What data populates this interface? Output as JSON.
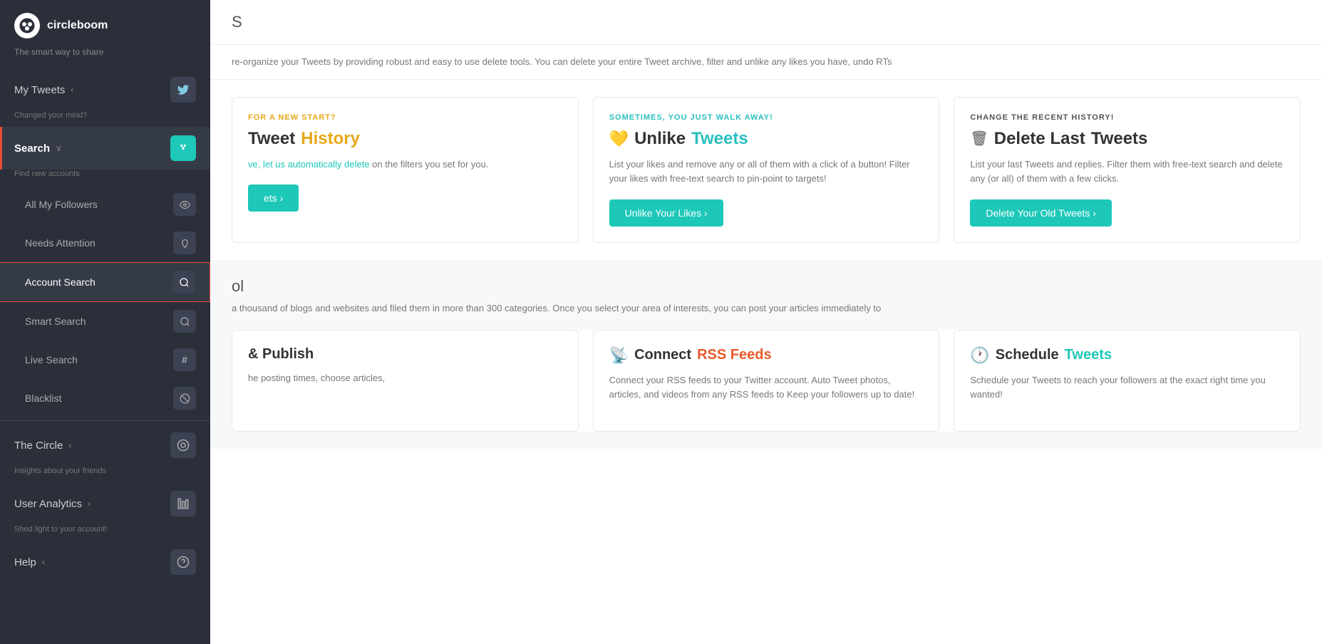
{
  "sidebar": {
    "logo_text": "circleboom",
    "tagline": "The smart way to share",
    "nav_items": [
      {
        "id": "my-tweets",
        "label": "My Tweets",
        "sublabel": "Changed your mind?",
        "icon": "🐦",
        "has_chevron": true,
        "active": false
      },
      {
        "id": "search",
        "label": "Search",
        "sublabel": "Find new accounts",
        "icon": "⚡",
        "has_chevron": true,
        "active": true
      },
      {
        "id": "the-circle",
        "label": "The Circle",
        "sublabel": "Insights about your friends",
        "icon": "◎",
        "has_chevron": true,
        "active": false
      },
      {
        "id": "user-analytics",
        "label": "User Analytics",
        "sublabel": "Shed light to your account!",
        "icon": "📊",
        "has_chevron": true,
        "active": false
      },
      {
        "id": "help",
        "label": "Help",
        "sublabel": "",
        "icon": "?",
        "has_chevron": true,
        "active": false
      }
    ],
    "search_sub_items": [
      {
        "id": "all-my-followers",
        "label": "All My Followers",
        "icon": "👁",
        "active": false
      },
      {
        "id": "needs-attention",
        "label": "Needs Attention",
        "icon": "☁",
        "active": false
      },
      {
        "id": "account-search",
        "label": "Account Search",
        "icon": "🔍",
        "active": true
      },
      {
        "id": "smart-search",
        "label": "Smart Search",
        "icon": "🔍",
        "active": false
      },
      {
        "id": "live-search",
        "label": "Live Search",
        "icon": "#",
        "active": false
      },
      {
        "id": "blacklist",
        "label": "Blacklist",
        "icon": "⊘",
        "active": false
      }
    ]
  },
  "main": {
    "header_title": "S",
    "description": "re-organize your Tweets by providing robust and easy to use delete tools. You can delete your entire Tweet archive, filter and unlike any likes you have, undo RTs",
    "cards_section1": {
      "cards": [
        {
          "id": "tweet-history",
          "subtitle": "FOR A NEW START?",
          "title_icon": "",
          "title_plain": "Tweet ",
          "title_colored": "History",
          "description": "ve, let us automatically delete on the filters you set for you.",
          "btn_label": "ets ›",
          "btn_color": "#1dc8b8"
        },
        {
          "id": "unlike-tweets",
          "subtitle": "SOMETIMES, YOU JUST WALK AWAY!",
          "title_icon": "💛",
          "title_plain": "Unlike ",
          "title_colored": "Tweets",
          "description": "List your likes and remove any or all of them with a click of a button! Filter your likes with free-text search to pin-point to targets!",
          "btn_label": "Unlike Your Likes ›",
          "btn_color": "#1dc8b8"
        },
        {
          "id": "delete-last-tweets",
          "subtitle": "CHANGE THE RECENT HISTORY!",
          "title_icon": "🗑",
          "title_plain": "Delete Last ",
          "title_colored": "Tweets",
          "description": "List your last Tweets and replies. Filter them with free-text search and delete any (or all) of them with a few clicks.",
          "btn_label": "Delete Your Old Tweets ›",
          "btn_color": "#1dc8b8"
        }
      ]
    },
    "section2": {
      "title": "ol",
      "description": "a thousand of blogs and websites and filed them in more than 300 categories. Once you select your area of interests, you can post your articles immediately to",
      "cards": [
        {
          "id": "publish",
          "subtitle": "",
          "title_icon": "",
          "title_plain": "& Publish",
          "title_colored": "",
          "description": "he posting times, choose articles,"
        },
        {
          "id": "connect-rss",
          "subtitle": "",
          "title_icon": "📡",
          "title_plain": "Connect ",
          "title_colored": "RSS Feeds",
          "description": "Connect your RSS feeds to your Twitter account. Auto Tweet photos, articles, and videos from any RSS feeds to Keep your followers up to date!"
        },
        {
          "id": "schedule-tweets",
          "subtitle": "",
          "title_icon": "🕐",
          "title_plain": "Schedule ",
          "title_colored": "Tweets",
          "description": "Schedule your Tweets to reach your followers at the exact right time you wanted!"
        }
      ]
    }
  }
}
